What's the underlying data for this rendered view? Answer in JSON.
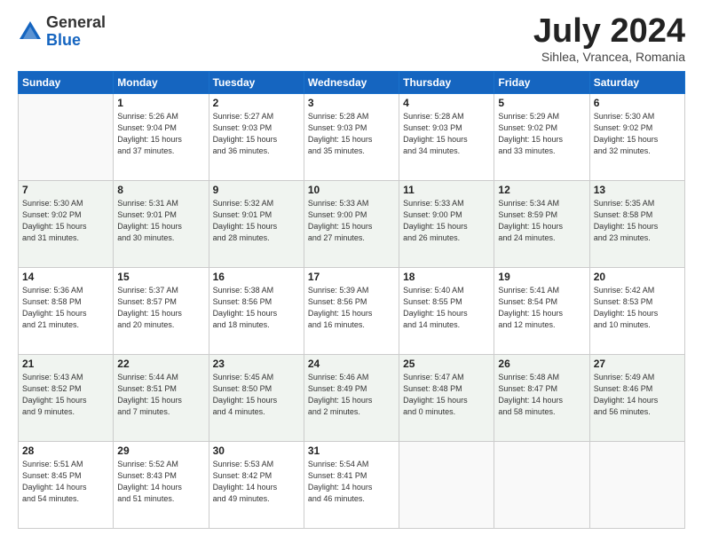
{
  "header": {
    "logo_general": "General",
    "logo_blue": "Blue",
    "month_year": "July 2024",
    "location": "Sihlea, Vrancea, Romania"
  },
  "columns": [
    "Sunday",
    "Monday",
    "Tuesday",
    "Wednesday",
    "Thursday",
    "Friday",
    "Saturday"
  ],
  "weeks": [
    [
      {
        "day": "",
        "info": ""
      },
      {
        "day": "1",
        "info": "Sunrise: 5:26 AM\nSunset: 9:04 PM\nDaylight: 15 hours\nand 37 minutes."
      },
      {
        "day": "2",
        "info": "Sunrise: 5:27 AM\nSunset: 9:03 PM\nDaylight: 15 hours\nand 36 minutes."
      },
      {
        "day": "3",
        "info": "Sunrise: 5:28 AM\nSunset: 9:03 PM\nDaylight: 15 hours\nand 35 minutes."
      },
      {
        "day": "4",
        "info": "Sunrise: 5:28 AM\nSunset: 9:03 PM\nDaylight: 15 hours\nand 34 minutes."
      },
      {
        "day": "5",
        "info": "Sunrise: 5:29 AM\nSunset: 9:02 PM\nDaylight: 15 hours\nand 33 minutes."
      },
      {
        "day": "6",
        "info": "Sunrise: 5:30 AM\nSunset: 9:02 PM\nDaylight: 15 hours\nand 32 minutes."
      }
    ],
    [
      {
        "day": "7",
        "info": "Sunrise: 5:30 AM\nSunset: 9:02 PM\nDaylight: 15 hours\nand 31 minutes."
      },
      {
        "day": "8",
        "info": "Sunrise: 5:31 AM\nSunset: 9:01 PM\nDaylight: 15 hours\nand 30 minutes."
      },
      {
        "day": "9",
        "info": "Sunrise: 5:32 AM\nSunset: 9:01 PM\nDaylight: 15 hours\nand 28 minutes."
      },
      {
        "day": "10",
        "info": "Sunrise: 5:33 AM\nSunset: 9:00 PM\nDaylight: 15 hours\nand 27 minutes."
      },
      {
        "day": "11",
        "info": "Sunrise: 5:33 AM\nSunset: 9:00 PM\nDaylight: 15 hours\nand 26 minutes."
      },
      {
        "day": "12",
        "info": "Sunrise: 5:34 AM\nSunset: 8:59 PM\nDaylight: 15 hours\nand 24 minutes."
      },
      {
        "day": "13",
        "info": "Sunrise: 5:35 AM\nSunset: 8:58 PM\nDaylight: 15 hours\nand 23 minutes."
      }
    ],
    [
      {
        "day": "14",
        "info": "Sunrise: 5:36 AM\nSunset: 8:58 PM\nDaylight: 15 hours\nand 21 minutes."
      },
      {
        "day": "15",
        "info": "Sunrise: 5:37 AM\nSunset: 8:57 PM\nDaylight: 15 hours\nand 20 minutes."
      },
      {
        "day": "16",
        "info": "Sunrise: 5:38 AM\nSunset: 8:56 PM\nDaylight: 15 hours\nand 18 minutes."
      },
      {
        "day": "17",
        "info": "Sunrise: 5:39 AM\nSunset: 8:56 PM\nDaylight: 15 hours\nand 16 minutes."
      },
      {
        "day": "18",
        "info": "Sunrise: 5:40 AM\nSunset: 8:55 PM\nDaylight: 15 hours\nand 14 minutes."
      },
      {
        "day": "19",
        "info": "Sunrise: 5:41 AM\nSunset: 8:54 PM\nDaylight: 15 hours\nand 12 minutes."
      },
      {
        "day": "20",
        "info": "Sunrise: 5:42 AM\nSunset: 8:53 PM\nDaylight: 15 hours\nand 10 minutes."
      }
    ],
    [
      {
        "day": "21",
        "info": "Sunrise: 5:43 AM\nSunset: 8:52 PM\nDaylight: 15 hours\nand 9 minutes."
      },
      {
        "day": "22",
        "info": "Sunrise: 5:44 AM\nSunset: 8:51 PM\nDaylight: 15 hours\nand 7 minutes."
      },
      {
        "day": "23",
        "info": "Sunrise: 5:45 AM\nSunset: 8:50 PM\nDaylight: 15 hours\nand 4 minutes."
      },
      {
        "day": "24",
        "info": "Sunrise: 5:46 AM\nSunset: 8:49 PM\nDaylight: 15 hours\nand 2 minutes."
      },
      {
        "day": "25",
        "info": "Sunrise: 5:47 AM\nSunset: 8:48 PM\nDaylight: 15 hours\nand 0 minutes."
      },
      {
        "day": "26",
        "info": "Sunrise: 5:48 AM\nSunset: 8:47 PM\nDaylight: 14 hours\nand 58 minutes."
      },
      {
        "day": "27",
        "info": "Sunrise: 5:49 AM\nSunset: 8:46 PM\nDaylight: 14 hours\nand 56 minutes."
      }
    ],
    [
      {
        "day": "28",
        "info": "Sunrise: 5:51 AM\nSunset: 8:45 PM\nDaylight: 14 hours\nand 54 minutes."
      },
      {
        "day": "29",
        "info": "Sunrise: 5:52 AM\nSunset: 8:43 PM\nDaylight: 14 hours\nand 51 minutes."
      },
      {
        "day": "30",
        "info": "Sunrise: 5:53 AM\nSunset: 8:42 PM\nDaylight: 14 hours\nand 49 minutes."
      },
      {
        "day": "31",
        "info": "Sunrise: 5:54 AM\nSunset: 8:41 PM\nDaylight: 14 hours\nand 46 minutes."
      },
      {
        "day": "",
        "info": ""
      },
      {
        "day": "",
        "info": ""
      },
      {
        "day": "",
        "info": ""
      }
    ]
  ]
}
